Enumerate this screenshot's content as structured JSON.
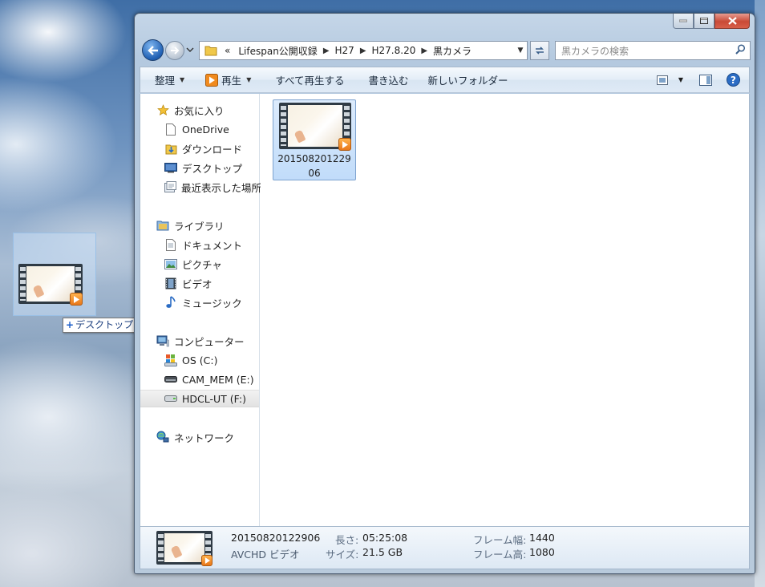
{
  "window": {
    "address": {
      "crumbs": [
        "«",
        "Lifespan公開収録",
        "H27",
        "H27.8.20",
        "黒カメラ"
      ],
      "crumb_separator": "▶"
    },
    "search": {
      "placeholder": "黒カメラの検索"
    },
    "toolbar": {
      "organize": "整理",
      "play": "再生",
      "play_all": "すべて再生する",
      "burn": "書き込む",
      "new_folder": "新しいフォルダー"
    },
    "nav": {
      "favorites": "お気に入り",
      "onedrive": "OneDrive",
      "downloads": "ダウンロード",
      "desktop": "デスクトップ",
      "recent": "最近表示した場所",
      "libraries": "ライブラリ",
      "documents": "ドキュメント",
      "pictures": "ピクチャ",
      "videos": "ビデオ",
      "music": "ミュージック",
      "computer": "コンピューター",
      "drive_c": "OS (C:)",
      "drive_e": "CAM_MEM (E:)",
      "drive_f": "HDCL-UT (F:)",
      "network": "ネットワーク"
    },
    "files": [
      {
        "name": "20150820122906"
      }
    ],
    "details": {
      "filename": "20150820122906",
      "type": "AVCHD ビデオ",
      "length_label": "長さ:",
      "length_value": "05:25:08",
      "size_label": "サイズ:",
      "size_value": "21.5 GB",
      "frame_width_label": "フレーム幅:",
      "frame_width_value": "1440",
      "frame_height_label": "フレーム高:",
      "frame_height_value": "1080"
    }
  },
  "drag": {
    "tooltip_plus": "+",
    "tooltip": "デスクトップ へコピー"
  },
  "colors": {
    "accent": "#1f5fb3",
    "selection": "#c1dcfa",
    "close": "#c94a36"
  }
}
